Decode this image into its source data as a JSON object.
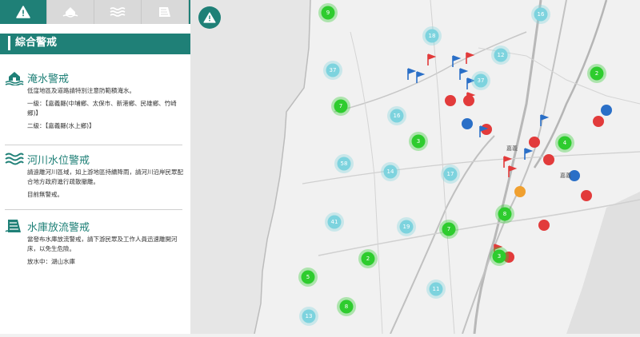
{
  "tabs": [
    {
      "name": "warning-icon",
      "active": true
    },
    {
      "name": "flood-house-icon",
      "active": false
    },
    {
      "name": "river-waves-icon",
      "active": false
    },
    {
      "name": "reservoir-dam-icon",
      "active": false
    }
  ],
  "panel": {
    "title": "綜合警戒"
  },
  "flood": {
    "title": "淹水警戒",
    "desc": "低窪地區及道路請特別注意防範積淹水。",
    "level1": "一級：【嘉義縣(中埔鄉、太保市、新港鄉、民雄鄉、竹崎鄉)】",
    "level2": "二級：【嘉義縣(水上鄉)】"
  },
  "river": {
    "title": "河川水位警戒",
    "desc": "請遠離河川區域，如上游地區持續降雨，請河川沿岸民眾配合地方政府進行疏散撤離。",
    "status": "目前無警戒。"
  },
  "reservoir": {
    "title": "水庫放流警戒",
    "desc": "當發布水庫放流警戒，請下游民眾及工作人員迅速離開河床，以免生危險。",
    "status": "放水中：湖山水庫"
  },
  "map": {
    "alert_icon": "warning-icon",
    "place_labels": [
      "嘉義",
      "嘉義"
    ],
    "colors": {
      "cluster_green": "#2ecc2e",
      "cluster_teal": "#7dd3de",
      "flag_red": "#e23b3b",
      "flag_blue": "#2a6fc7",
      "accent": "#1f8077"
    },
    "clusters": [
      {
        "label": "9",
        "color": "green"
      },
      {
        "label": "16",
        "color": "teal"
      },
      {
        "label": "18",
        "color": "teal"
      },
      {
        "label": "12",
        "color": "teal"
      },
      {
        "label": "37",
        "color": "teal"
      },
      {
        "label": "37",
        "color": "teal"
      },
      {
        "label": "2",
        "color": "green"
      },
      {
        "label": "7",
        "color": "green"
      },
      {
        "label": "16",
        "color": "teal"
      },
      {
        "label": "3",
        "color": "green"
      },
      {
        "label": "4",
        "color": "green"
      },
      {
        "label": "58",
        "color": "teal"
      },
      {
        "label": "14",
        "color": "teal"
      },
      {
        "label": "17",
        "color": "teal"
      },
      {
        "label": "8",
        "color": "green"
      },
      {
        "label": "41",
        "color": "teal"
      },
      {
        "label": "19",
        "color": "teal"
      },
      {
        "label": "7",
        "color": "green"
      },
      {
        "label": "2",
        "color": "green"
      },
      {
        "label": "3",
        "color": "green"
      },
      {
        "label": "5",
        "color": "green"
      },
      {
        "label": "11",
        "color": "teal"
      },
      {
        "label": "8",
        "color": "green"
      },
      {
        "label": "13",
        "color": "teal"
      }
    ]
  }
}
